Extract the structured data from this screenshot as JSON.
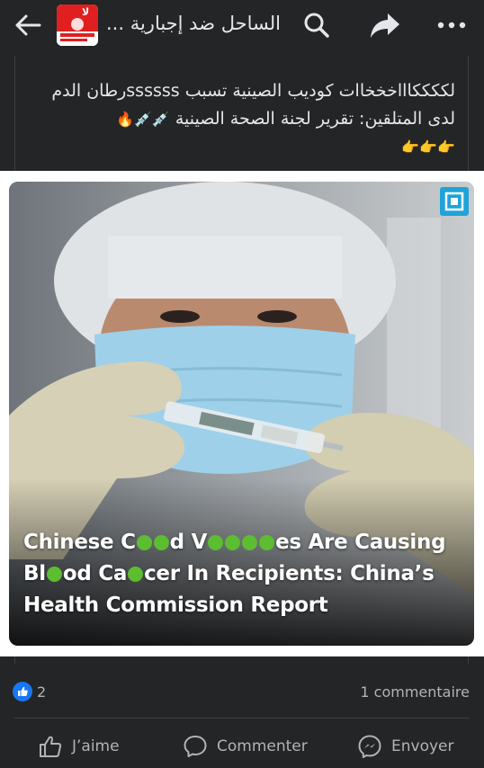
{
  "header": {
    "title": "الساحل ضد إجبارية ...",
    "avatar_text": "لا",
    "back_icon": "arrow-left-icon",
    "search_icon": "search-icon",
    "share_icon": "share-arrow-icon",
    "more_icon": "more-dots-icon"
  },
  "post": {
    "text_line1": "لككككاااخخخاات كوديب الصينية تسبب ssssssرطان الدم",
    "text_line2": "لدى المتلقين: تقرير لجنة الصحة الصينية",
    "text_emojis": "💉💉🔥",
    "pointing_emojis": "👉👉👉",
    "image": {
      "headline": "Chinese Co⬤⬤d Va⬤⬤i⬤⬤s Are Causing Bl⬤od Ca⬤cer In Recipients: China’s Health Commission Report",
      "headline_line1": "Chinese C⬤⬤d V⬤⬤⬤⬤es Are Causing",
      "headline_line2": "Bl⬤od Ca⬤cer In Recipients: China’s",
      "headline_line3": "Health Commission Report",
      "badge_icon": "brand-logo-icon"
    }
  },
  "stats": {
    "like_count": "2",
    "comments_label": "1 commentaire"
  },
  "actions": {
    "like_label": "J’aime",
    "comment_label": "Commenter",
    "send_label": "Envoyer"
  },
  "colors": {
    "background": "#242526",
    "text": "#e4e6eb",
    "muted": "#b0b3b8",
    "like_blue": "#1877f2",
    "censor_green": "#5bbd2f"
  }
}
